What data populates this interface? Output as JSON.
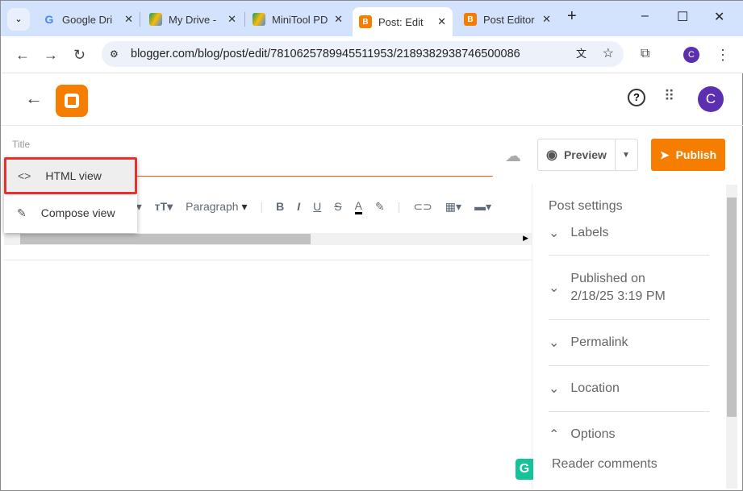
{
  "browser": {
    "tabs": [
      {
        "label": "Google Dri",
        "icon": "google-icon"
      },
      {
        "label": "My Drive -",
        "icon": "drive-icon"
      },
      {
        "label": "MiniTool PD",
        "icon": "drive-icon"
      },
      {
        "label": "Post: Edit",
        "icon": "blogger-icon",
        "active": true
      },
      {
        "label": "Post Editor",
        "icon": "blogger-icon"
      }
    ],
    "url": "blogger.com/blog/post/edit/7810625789945511953/2189382938746500086",
    "profile_initial": "C"
  },
  "app": {
    "avatar_initial": "C",
    "brand_color": "#f57d00"
  },
  "editor": {
    "title_label": "Title",
    "preview_label": "Preview",
    "publish_label": "Publish",
    "paragraph_label": "Paragraph",
    "view_menu": [
      {
        "label": "HTML view",
        "icon": "code-icon",
        "selected": true
      },
      {
        "label": "Compose view",
        "icon": "pencil-icon"
      }
    ]
  },
  "settings": {
    "title": "Post settings",
    "labels": "Labels",
    "published_on": "Published on",
    "published_date": "2/18/25 3:19 PM",
    "permalink": "Permalink",
    "location": "Location",
    "options": "Options",
    "reader_comments": "Reader comments"
  }
}
